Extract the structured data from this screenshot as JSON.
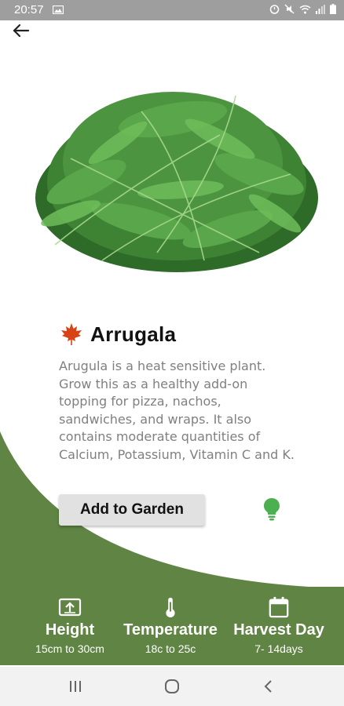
{
  "status_bar": {
    "time": "20:57",
    "icons": [
      "image-icon",
      "alarm-icon",
      "mute-icon",
      "wifi-icon",
      "signal-icon",
      "battery-icon"
    ]
  },
  "header": {
    "back_icon": "arrow-left-icon"
  },
  "plant": {
    "emoji_icon": "maple-leaf-icon",
    "name": "Arrugala",
    "description": "Arugula is a heat sensitive plant. Grow this as a healthy add-on topping for pizza, nachos, sandwiches, and wraps. It also contains moderate quantities of Calcium, Potassium, Vitamin C and K.",
    "image_icon": "arugula-photo"
  },
  "actions": {
    "add_label": "Add to Garden",
    "tip_icon": "lightbulb-icon"
  },
  "stats": [
    {
      "icon": "height-icon",
      "label": "Height",
      "value": "15cm to 30cm"
    },
    {
      "icon": "thermometer-icon",
      "label": "Temperature",
      "value": "18c to 25c"
    },
    {
      "icon": "calendar-icon",
      "label": "Harvest Day",
      "value": "7- 14days"
    }
  ],
  "nav": {
    "icons": [
      "recents-icon",
      "home-icon",
      "back-icon"
    ]
  },
  "colors": {
    "accent_green": "#5f8443",
    "bulb_green": "#4caf50",
    "status_bar": "#9e9e9e",
    "nav_bar": "#f2f2f2"
  }
}
